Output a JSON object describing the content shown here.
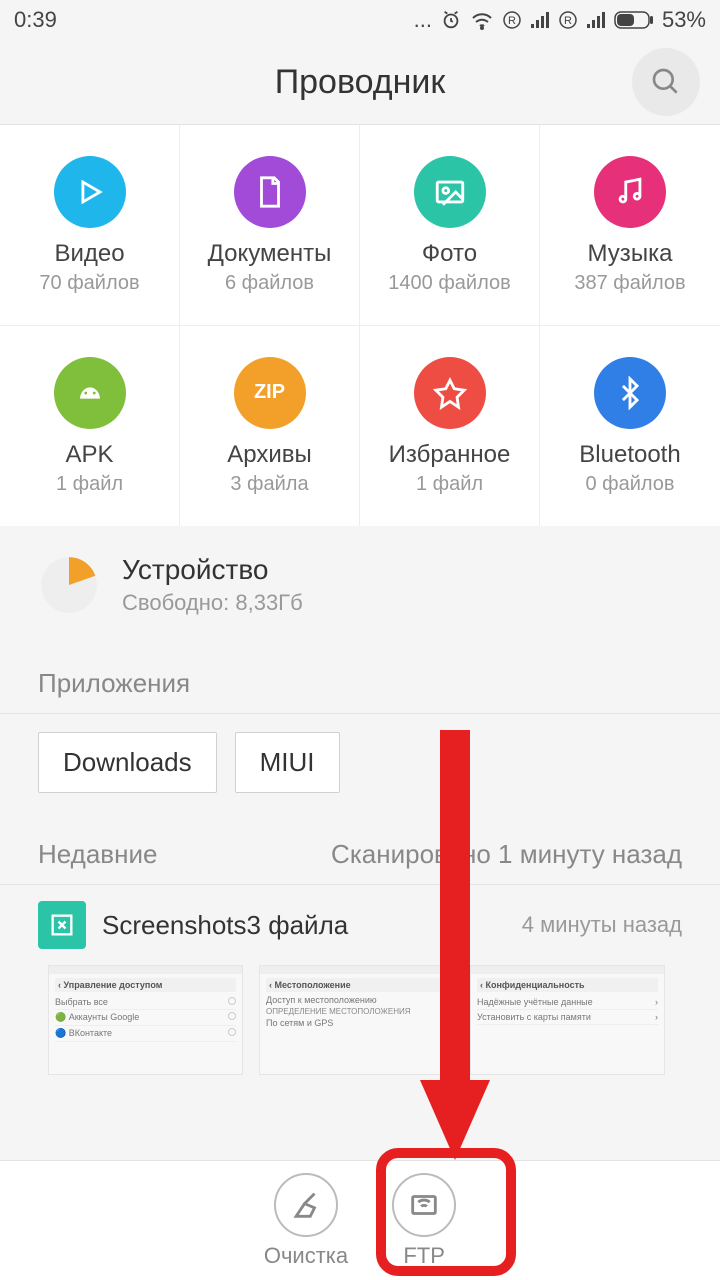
{
  "status": {
    "time": "0:39",
    "battery": "53%"
  },
  "header": {
    "title": "Проводник"
  },
  "categories_top": [
    {
      "label": "Видео",
      "count": "70 файлов",
      "color": "#1fb6ec",
      "icon": "play"
    },
    {
      "label": "Документы",
      "count": "6 файлов",
      "color": "#a14bd8",
      "icon": "doc"
    },
    {
      "label": "Фото",
      "count": "1400 файлов",
      "color": "#2bc4a6",
      "icon": "photo"
    },
    {
      "label": "Музыка",
      "count": "387 файлов",
      "color": "#e6317a",
      "icon": "music"
    }
  ],
  "categories_bottom": [
    {
      "label": "APK",
      "count": "1 файл",
      "color": "#7fbf3b",
      "icon": "apk"
    },
    {
      "label": "Архивы",
      "count": "3 файла",
      "color": "#f2a029",
      "icon": "zip"
    },
    {
      "label": "Избранное",
      "count": "1 файл",
      "color": "#ee4d44",
      "icon": "star"
    },
    {
      "label": "Bluetooth",
      "count": "0 файлов",
      "color": "#2f7fe6",
      "icon": "bt"
    }
  ],
  "storage": {
    "title": "Устройство",
    "sub": "Свободно: 8,33Гб"
  },
  "apps": {
    "title": "Приложения",
    "items": [
      "Downloads",
      "MIUI"
    ]
  },
  "recent": {
    "title": "Недавние",
    "scanned": "Сканировано 1 минуту назад",
    "item_label": "Screenshots3 файла",
    "item_time": "4 минуты назад"
  },
  "bottom": {
    "clean": "Очистка",
    "ftp": "FTP"
  }
}
